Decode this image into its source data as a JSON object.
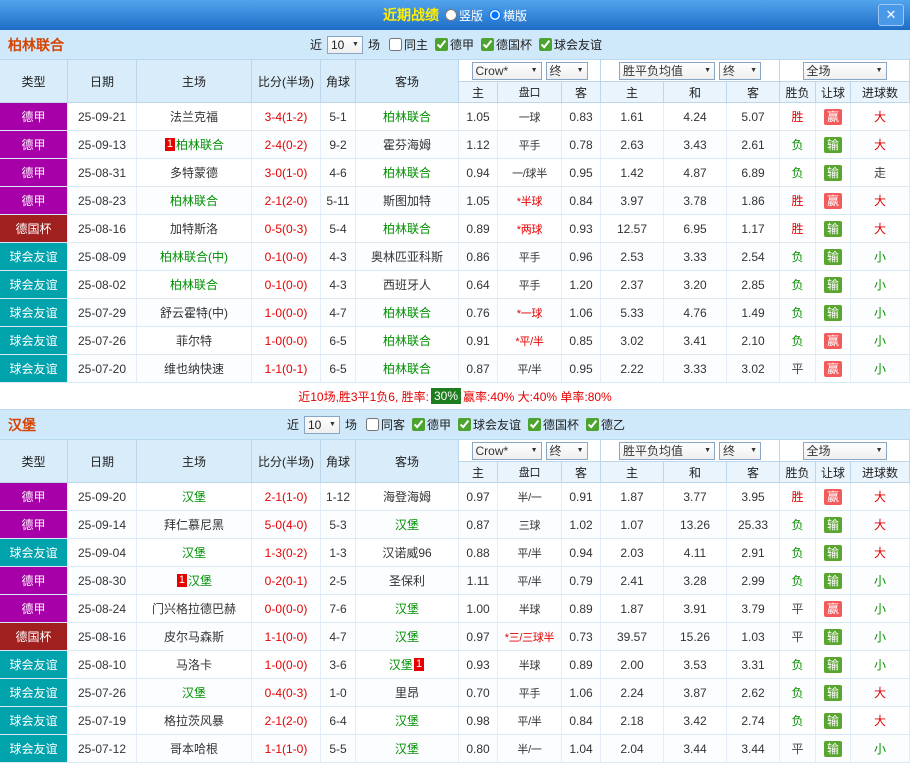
{
  "header": {
    "title": "近期战绩",
    "radio_vertical": "竖版",
    "radio_horizontal": "横版",
    "close_label": "✕"
  },
  "colors": {
    "titlebar_blue": "#1d6dc7",
    "title_yellow": "#ffee00",
    "team_name_orange": "#d64300",
    "league_bundesliga": "#a800a8",
    "league_german_cup": "#a02020",
    "league_friendly": "#00a2ab",
    "win_red": "#e60000",
    "lose_green": "#089000",
    "handicap_win_badge": "#f25b5b",
    "handicap_lose_badge": "#58a52f",
    "rate_badge_green": "#1e7d1e"
  },
  "table": {
    "left_columns": [
      "类型",
      "日期",
      "主场",
      "比分(半场)",
      "角球",
      "客场"
    ],
    "sub_columns": [
      "主",
      "盘口",
      "客",
      "主",
      "和",
      "客",
      "胜负",
      "让球",
      "进球数"
    ]
  },
  "sections": [
    {
      "team": "柏林联合",
      "filter": {
        "prefix": "近",
        "count": "10",
        "suffix": "场",
        "checkboxes": [
          {
            "label": "同主",
            "checked": false
          },
          {
            "label": "德甲",
            "checked": true
          },
          {
            "label": "德国杯",
            "checked": true
          },
          {
            "label": "球会友谊",
            "checked": true
          }
        ]
      },
      "dropdowns": {
        "bookmaker": "Crow*",
        "bookmaker_time": "终",
        "avg": "胜平负均值",
        "avg_time": "终",
        "scope": "全场"
      },
      "rows": [
        {
          "league": "德甲",
          "league_class": "lg-purple",
          "date": "25-09-21",
          "home": "法兰克福",
          "score": "3-4(1-2)",
          "corner": "5-1",
          "away": "柏林联合",
          "away_focus": true,
          "odds1": "1.05",
          "handicap": "一球",
          "odds2": "0.83",
          "avg_win": "1.61",
          "avg_draw": "4.24",
          "avg_lose": "5.07",
          "result": "胜",
          "result_class": "r-win",
          "asian": "赢",
          "asian_class": "a-win",
          "goals": "大",
          "goals_class": "g-big"
        },
        {
          "league": "德甲",
          "league_class": "lg-purple",
          "date": "25-09-13",
          "home": "柏林联合",
          "home_focus": true,
          "home_badge_pre": "1",
          "score": "2-4(0-2)",
          "corner": "9-2",
          "away": "霍芬海姆",
          "odds1": "1.12",
          "handicap": "平手",
          "odds2": "0.78",
          "avg_win": "2.63",
          "avg_draw": "3.43",
          "avg_lose": "2.61",
          "result": "负",
          "result_class": "r-lose",
          "asian": "输",
          "asian_class": "a-lose",
          "goals": "大",
          "goals_class": "g-big"
        },
        {
          "league": "德甲",
          "league_class": "lg-purple",
          "date": "25-08-31",
          "home": "多特蒙德",
          "score": "3-0(1-0)",
          "corner": "4-6",
          "away": "柏林联合",
          "away_focus": true,
          "odds1": "0.94",
          "handicap": "一/球半",
          "odds2": "0.95",
          "avg_win": "1.42",
          "avg_draw": "4.87",
          "avg_lose": "6.89",
          "result": "负",
          "result_class": "r-lose",
          "asian": "输",
          "asian_class": "a-lose",
          "goals": "走",
          "goals_class": "g-push"
        },
        {
          "league": "德甲",
          "league_class": "lg-purple",
          "date": "25-08-23",
          "home": "柏林联合",
          "home_focus": true,
          "score": "2-1(2-0)",
          "corner": "5-11",
          "away": "斯图加特",
          "odds1": "1.05",
          "handicap": "*半球",
          "handicap_red": true,
          "odds2": "0.84",
          "avg_win": "3.97",
          "avg_draw": "3.78",
          "avg_lose": "1.86",
          "result": "胜",
          "result_class": "r-win",
          "asian": "赢",
          "asian_class": "a-win",
          "goals": "大",
          "goals_class": "g-big"
        },
        {
          "league": "德国杯",
          "league_class": "lg-darkred",
          "date": "25-08-16",
          "home": "加特斯洛",
          "score": "0-5(0-3)",
          "corner": "5-4",
          "away": "柏林联合",
          "away_focus": true,
          "odds1": "0.89",
          "handicap": "*两球",
          "handicap_red": true,
          "odds2": "0.93",
          "avg_win": "12.57",
          "avg_draw": "6.95",
          "avg_lose": "1.17",
          "result": "胜",
          "result_class": "r-win",
          "asian": "输",
          "asian_class": "a-lose",
          "goals": "大",
          "goals_class": "g-big"
        },
        {
          "league": "球会友谊",
          "league_class": "lg-teal",
          "date": "25-08-09",
          "home": "柏林联合(中)",
          "home_focus": true,
          "score": "0-1(0-0)",
          "corner": "4-3",
          "away": "奥林匹亚科斯",
          "odds1": "0.86",
          "handicap": "平手",
          "odds2": "0.96",
          "avg_win": "2.53",
          "avg_draw": "3.33",
          "avg_lose": "2.54",
          "result": "负",
          "result_class": "r-lose",
          "asian": "输",
          "asian_class": "a-lose",
          "goals": "小",
          "goals_class": "g-small"
        },
        {
          "league": "球会友谊",
          "league_class": "lg-teal",
          "date": "25-08-02",
          "home": "柏林联合",
          "home_focus": true,
          "score": "0-1(0-0)",
          "corner": "4-3",
          "away": "西班牙人",
          "odds1": "0.64",
          "handicap": "平手",
          "odds2": "1.20",
          "avg_win": "2.37",
          "avg_draw": "3.20",
          "avg_lose": "2.85",
          "result": "负",
          "result_class": "r-lose",
          "asian": "输",
          "asian_class": "a-lose",
          "goals": "小",
          "goals_class": "g-small"
        },
        {
          "league": "球会友谊",
          "league_class": "lg-teal",
          "date": "25-07-29",
          "home": "舒云霍特(中)",
          "score": "1-0(0-0)",
          "corner": "4-7",
          "away": "柏林联合",
          "away_focus": true,
          "odds1": "0.76",
          "handicap": "*一球",
          "handicap_red": true,
          "odds2": "1.06",
          "avg_win": "5.33",
          "avg_draw": "4.76",
          "avg_lose": "1.49",
          "result": "负",
          "result_class": "r-lose",
          "asian": "输",
          "asian_class": "a-lose",
          "goals": "小",
          "goals_class": "g-small"
        },
        {
          "league": "球会友谊",
          "league_class": "lg-teal",
          "date": "25-07-26",
          "home": "菲尔特",
          "score": "1-0(0-0)",
          "corner": "6-5",
          "away": "柏林联合",
          "away_focus": true,
          "odds1": "0.91",
          "handicap": "*平/半",
          "handicap_red": true,
          "odds2": "0.85",
          "avg_win": "3.02",
          "avg_draw": "3.41",
          "avg_lose": "2.10",
          "result": "负",
          "result_class": "r-lose",
          "asian": "赢",
          "asian_class": "a-win",
          "goals": "小",
          "goals_class": "g-small"
        },
        {
          "league": "球会友谊",
          "league_class": "lg-teal",
          "date": "25-07-20",
          "home": "维也纳快速",
          "score": "1-1(0-1)",
          "corner": "6-5",
          "away": "柏林联合",
          "away_focus": true,
          "odds1": "0.87",
          "handicap": "平/半",
          "odds2": "0.95",
          "avg_win": "2.22",
          "avg_draw": "3.33",
          "avg_lose": "3.02",
          "result": "平",
          "result_class": "r-draw",
          "asian": "赢",
          "asian_class": "a-win",
          "goals": "小",
          "goals_class": "g-small"
        }
      ],
      "summary": {
        "pre": "近10场,胜3平1负6, 胜率:",
        "badge": "30%",
        "post": " 赢率:40% 大:40% 单率:80%"
      }
    },
    {
      "team": "汉堡",
      "filter": {
        "prefix": "近",
        "count": "10",
        "suffix": "场",
        "checkboxes": [
          {
            "label": "同客",
            "checked": false
          },
          {
            "label": "德甲",
            "checked": true
          },
          {
            "label": "球会友谊",
            "checked": true
          },
          {
            "label": "德国杯",
            "checked": true
          },
          {
            "label": "德乙",
            "checked": true
          }
        ]
      },
      "dropdowns": {
        "bookmaker": "Crow*",
        "bookmaker_time": "终",
        "avg": "胜平负均值",
        "avg_time": "终",
        "scope": "全场"
      },
      "rows": [
        {
          "league": "德甲",
          "league_class": "lg-purple",
          "date": "25-09-20",
          "home": "汉堡",
          "home_focus": true,
          "score": "2-1(1-0)",
          "corner": "1-12",
          "away": "海登海姆",
          "odds1": "0.97",
          "handicap": "半/一",
          "odds2": "0.91",
          "avg_win": "1.87",
          "avg_draw": "3.77",
          "avg_lose": "3.95",
          "result": "胜",
          "result_class": "r-win",
          "asian": "赢",
          "asian_class": "a-win",
          "goals": "大",
          "goals_class": "g-big"
        },
        {
          "league": "德甲",
          "league_class": "lg-purple",
          "date": "25-09-14",
          "home": "拜仁慕尼黑",
          "score": "5-0(4-0)",
          "corner": "5-3",
          "away": "汉堡",
          "away_focus": true,
          "odds1": "0.87",
          "handicap": "三球",
          "odds2": "1.02",
          "avg_win": "1.07",
          "avg_draw": "13.26",
          "avg_lose": "25.33",
          "result": "负",
          "result_class": "r-lose",
          "asian": "输",
          "asian_class": "a-lose",
          "goals": "大",
          "goals_class": "g-big"
        },
        {
          "league": "球会友谊",
          "league_class": "lg-teal",
          "date": "25-09-04",
          "home": "汉堡",
          "home_focus": true,
          "score": "1-3(0-2)",
          "corner": "1-3",
          "away": "汉诺威96",
          "odds1": "0.88",
          "handicap": "平/半",
          "odds2": "0.94",
          "avg_win": "2.03",
          "avg_draw": "4.11",
          "avg_lose": "2.91",
          "result": "负",
          "result_class": "r-lose",
          "asian": "输",
          "asian_class": "a-lose",
          "goals": "大",
          "goals_class": "g-big"
        },
        {
          "league": "德甲",
          "league_class": "lg-purple",
          "date": "25-08-30",
          "home": "汉堡",
          "home_focus": true,
          "home_badge_pre": "1",
          "score": "0-2(0-1)",
          "corner": "2-5",
          "away": "圣保利",
          "odds1": "1.11",
          "handicap": "平/半",
          "odds2": "0.79",
          "avg_win": "2.41",
          "avg_draw": "3.28",
          "avg_lose": "2.99",
          "result": "负",
          "result_class": "r-lose",
          "asian": "输",
          "asian_class": "a-lose",
          "goals": "小",
          "goals_class": "g-small"
        },
        {
          "league": "德甲",
          "league_class": "lg-purple",
          "date": "25-08-24",
          "home": "门兴格拉德巴赫",
          "score": "0-0(0-0)",
          "corner": "7-6",
          "away": "汉堡",
          "away_focus": true,
          "odds1": "1.00",
          "handicap": "半球",
          "odds2": "0.89",
          "avg_win": "1.87",
          "avg_draw": "3.91",
          "avg_lose": "3.79",
          "result": "平",
          "result_class": "r-draw",
          "asian": "赢",
          "asian_class": "a-win",
          "goals": "小",
          "goals_class": "g-small"
        },
        {
          "league": "德国杯",
          "league_class": "lg-darkred",
          "date": "25-08-16",
          "home": "皮尔马森斯",
          "score": "1-1(0-0)",
          "corner": "4-7",
          "away": "汉堡",
          "away_focus": true,
          "odds1": "0.97",
          "handicap": "*三/三球半",
          "handicap_red": true,
          "odds2": "0.73",
          "avg_win": "39.57",
          "avg_draw": "15.26",
          "avg_lose": "1.03",
          "result": "平",
          "result_class": "r-draw",
          "asian": "输",
          "asian_class": "a-lose",
          "goals": "小",
          "goals_class": "g-small"
        },
        {
          "league": "球会友谊",
          "league_class": "lg-teal",
          "date": "25-08-10",
          "home": "马洛卡",
          "score": "1-0(0-0)",
          "corner": "3-6",
          "away": "汉堡",
          "away_focus": true,
          "away_badge_post": "1",
          "odds1": "0.93",
          "handicap": "半球",
          "odds2": "0.89",
          "avg_win": "2.00",
          "avg_draw": "3.53",
          "avg_lose": "3.31",
          "result": "负",
          "result_class": "r-lose",
          "asian": "输",
          "asian_class": "a-lose",
          "goals": "小",
          "goals_class": "g-small"
        },
        {
          "league": "球会友谊",
          "league_class": "lg-teal",
          "date": "25-07-26",
          "home": "汉堡",
          "home_focus": true,
          "score": "0-4(0-3)",
          "corner": "1-0",
          "away": "里昂",
          "odds1": "0.70",
          "handicap": "平手",
          "odds2": "1.06",
          "avg_win": "2.24",
          "avg_draw": "3.87",
          "avg_lose": "2.62",
          "result": "负",
          "result_class": "r-lose",
          "asian": "输",
          "asian_class": "a-lose",
          "goals": "大",
          "goals_class": "g-big"
        },
        {
          "league": "球会友谊",
          "league_class": "lg-teal",
          "date": "25-07-19",
          "home": "格拉茨风暴",
          "score": "2-1(2-0)",
          "corner": "6-4",
          "away": "汉堡",
          "away_focus": true,
          "odds1": "0.98",
          "handicap": "平/半",
          "odds2": "0.84",
          "avg_win": "2.18",
          "avg_draw": "3.42",
          "avg_lose": "2.74",
          "result": "负",
          "result_class": "r-lose",
          "asian": "输",
          "asian_class": "a-lose",
          "goals": "大",
          "goals_class": "g-big"
        },
        {
          "league": "球会友谊",
          "league_class": "lg-teal",
          "date": "25-07-12",
          "home": "哥本哈根",
          "score": "1-1(1-0)",
          "corner": "5-5",
          "away": "汉堡",
          "away_focus": true,
          "odds1": "0.80",
          "handicap": "半/一",
          "odds2": "1.04",
          "avg_win": "2.04",
          "avg_draw": "3.44",
          "avg_lose": "3.44",
          "result": "平",
          "result_class": "r-draw",
          "asian": "输",
          "asian_class": "a-lose",
          "goals": "小",
          "goals_class": "g-small"
        }
      ]
    }
  ]
}
